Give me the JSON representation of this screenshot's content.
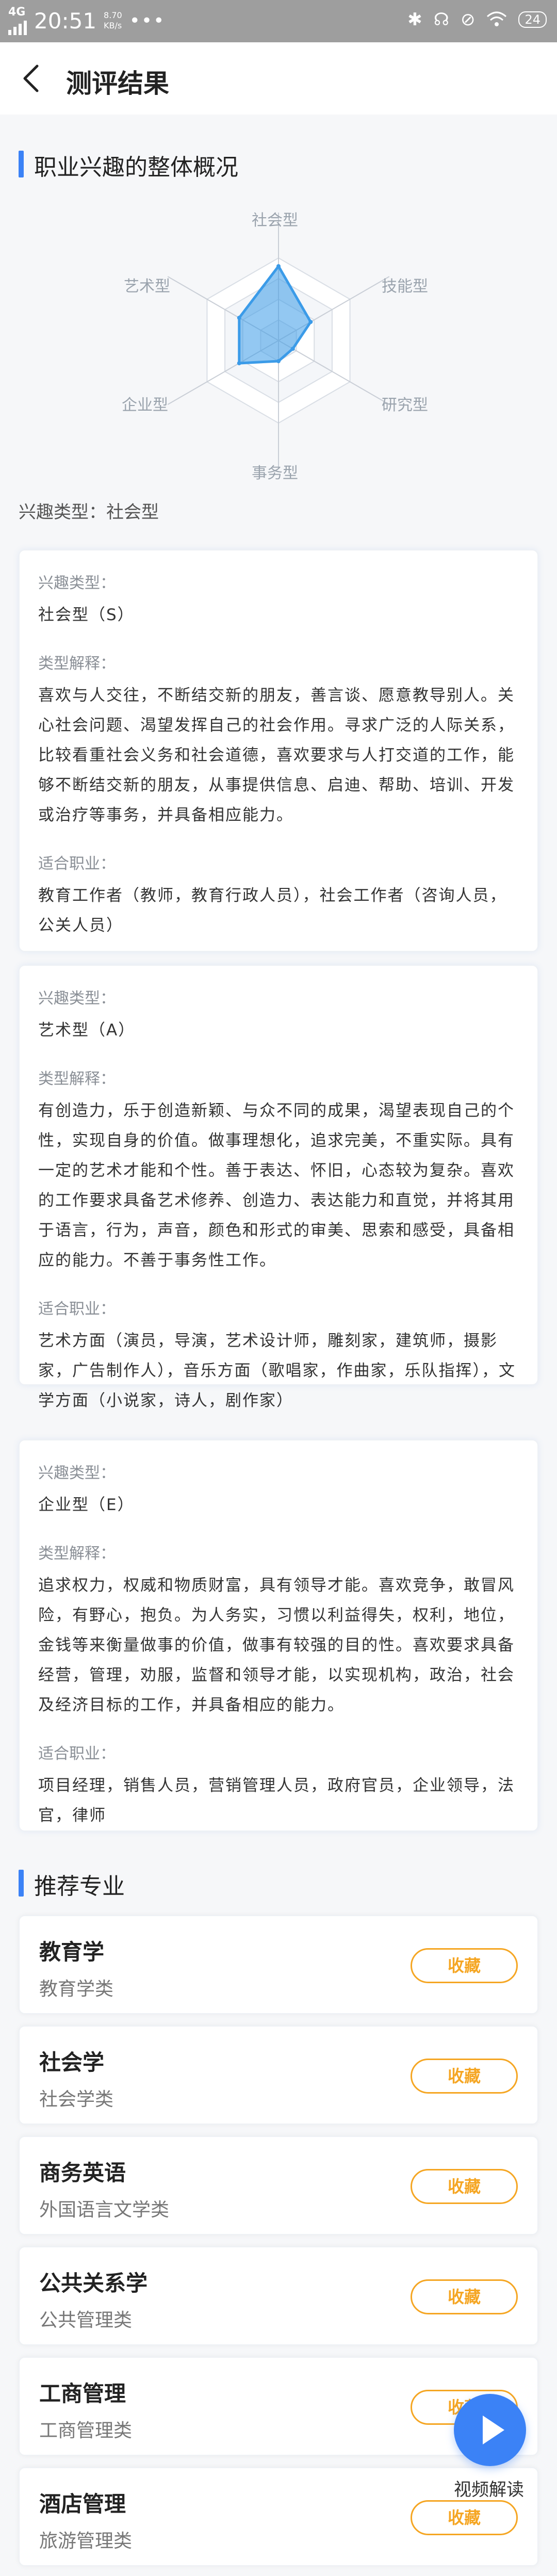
{
  "status_bar": {
    "network": "4G",
    "time": "20:51",
    "speed_value": "8.70",
    "speed_unit": "KB/s",
    "dots": "•••",
    "battery": "24"
  },
  "header": {
    "title": "测评结果"
  },
  "overview": {
    "title": "职业兴趣的整体概况",
    "radar": {
      "labels": {
        "top": "社会型",
        "top_right": "技能型",
        "bottom_right": "研究型",
        "bottom": "事务型",
        "bottom_left": "企业型",
        "top_left": "艺术型"
      },
      "order": [
        "社会型",
        "技能型",
        "研究型",
        "事务型",
        "企业型",
        "艺术型"
      ],
      "values": [
        0.9,
        0.45,
        0.2,
        0.25,
        0.55,
        0.55
      ],
      "color": "#3b9be8"
    },
    "interest_type": "兴趣类型：社会型"
  },
  "cards": [
    {
      "type_label": "兴趣类型：",
      "type_value": "社会型（S）",
      "explain_label": "类型解释：",
      "explain": "喜欢与人交往，不断结交新的朋友，善言谈、愿意教导别人。关心社会问题、渴望发挥自己的社会作用。寻求广泛的人际关系，比较看重社会义务和社会道德，喜欢要求与人打交道的工作，能够不断结交新的朋友，从事提供信息、启迪、帮助、培训、开发或治疗等事务，并具备相应能力。",
      "jobs_label": "适合职业：",
      "jobs": "教育工作者（教师，教育行政人员），社会工作者（咨询人员，公关人员）"
    },
    {
      "type_label": "兴趣类型：",
      "type_value": "艺术型（A）",
      "explain_label": "类型解释：",
      "explain": "有创造力，乐于创造新颖、与众不同的成果，渴望表现自己的个性，实现自身的价值。做事理想化，追求完美，不重实际。具有一定的艺术才能和个性。善于表达、怀旧，心态较为复杂。喜欢的工作要求具备艺术修养、创造力、表达能力和直觉，并将其用于语言，行为，声音，颜色和形式的审美、思索和感受，具备相应的能力。不善于事务性工作。",
      "jobs_label": "适合职业：",
      "jobs": "艺术方面（演员，导演，艺术设计师，雕刻家，建筑师，摄影家，广告制作人），音乐方面（歌唱家，作曲家，乐队指挥），文学方面（小说家，诗人，剧作家）"
    },
    {
      "type_label": "兴趣类型：",
      "type_value": "企业型（E）",
      "explain_label": "类型解释：",
      "explain": "追求权力，权威和物质财富，具有领导才能。喜欢竞争，敢冒风险，有野心，抱负。为人务实，习惯以利益得失，权利，地位，金钱等来衡量做事的价值，做事有较强的目的性。喜欢要求具备经营，管理，劝服，监督和领导才能，以实现机构，政治，社会及经济目标的工作，并具备相应的能力。",
      "jobs_label": "适合职业：",
      "jobs": "项目经理，销售人员，营销管理人员，政府官员，企业领导，法官，律师"
    }
  ],
  "recommend": {
    "title": "推荐专业",
    "fav_label": "收藏",
    "majors": [
      {
        "name": "教育学",
        "category": "教育学类"
      },
      {
        "name": "社会学",
        "category": "社会学类"
      },
      {
        "name": "商务英语",
        "category": "外国语言文学类"
      },
      {
        "name": "公共关系学",
        "category": "公共管理类"
      },
      {
        "name": "工商管理",
        "category": "工商管理类"
      },
      {
        "name": "酒店管理",
        "category": "旅游管理类"
      }
    ]
  },
  "float": {
    "label": "视频解读"
  },
  "colors": {
    "accent": "#3b82f6",
    "fav": "#f5a623",
    "radar": "#3b9be8"
  }
}
